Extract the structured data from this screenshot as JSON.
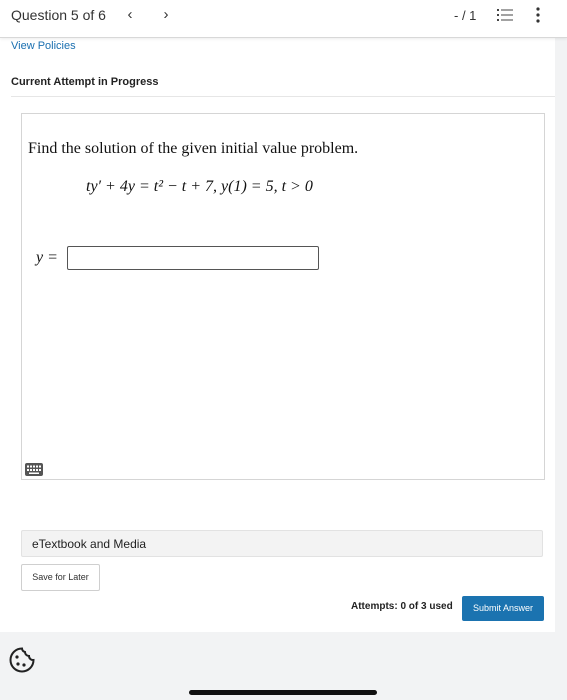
{
  "topbar": {
    "question_counter": "Question 5 of 6",
    "prev_icon": "chevron-left-icon",
    "next_icon": "chevron-right-icon",
    "score": "- / 1",
    "list_icon": "question-list-icon",
    "more_icon": "more-vertical-icon"
  },
  "header": {
    "view_policies": "View Policies",
    "attempt_status": "Current Attempt in Progress"
  },
  "question": {
    "prompt": "Find the solution of the given initial value problem.",
    "equation": "ty′ + 4y = t² − t + 7,  y(1) = 5,  t > 0",
    "answer_label": "y =",
    "answer_value": "",
    "keyboard_icon": "keyboard-icon"
  },
  "resources": {
    "etextbook_label": "eTextbook and Media"
  },
  "actions": {
    "save_later": "Save for Later",
    "attempts": "Attempts: 0 of 3 used",
    "submit": "Submit Answer"
  },
  "misc": {
    "cookie_icon": "cookie-settings-icon"
  },
  "colors": {
    "accent": "#1b73b0",
    "link": "#1a6fb0"
  }
}
